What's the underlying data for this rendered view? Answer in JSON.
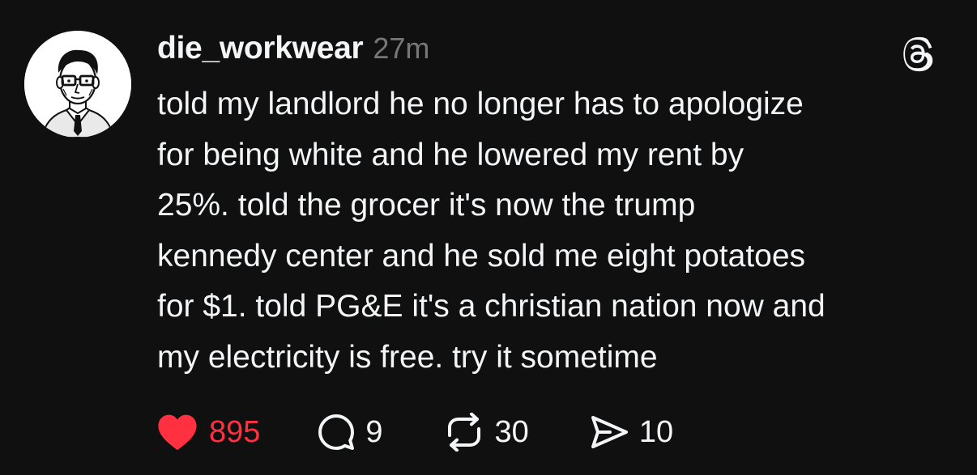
{
  "post": {
    "username": "die_workwear",
    "timestamp": "27m",
    "text": "told my landlord he no longer has to apologize\nfor being white and he lowered my rent by\n25%. told the grocer it's now the trump\nkennedy center and he sold me eight potatoes\nfor $1. told PG&E it's a christian nation now and\nmy electricity is free. try it sometime",
    "avatar_icon": "avatar-illustration-man-with-glasses",
    "logo_icon": "threads-logo-icon"
  },
  "actions": {
    "like_count": "895",
    "reply_count": "9",
    "repost_count": "30",
    "share_count": "10",
    "like_state": "liked"
  },
  "colors": {
    "background": "#101010",
    "text": "#f3f5f7",
    "muted": "#777777",
    "like": "#ff3040"
  }
}
